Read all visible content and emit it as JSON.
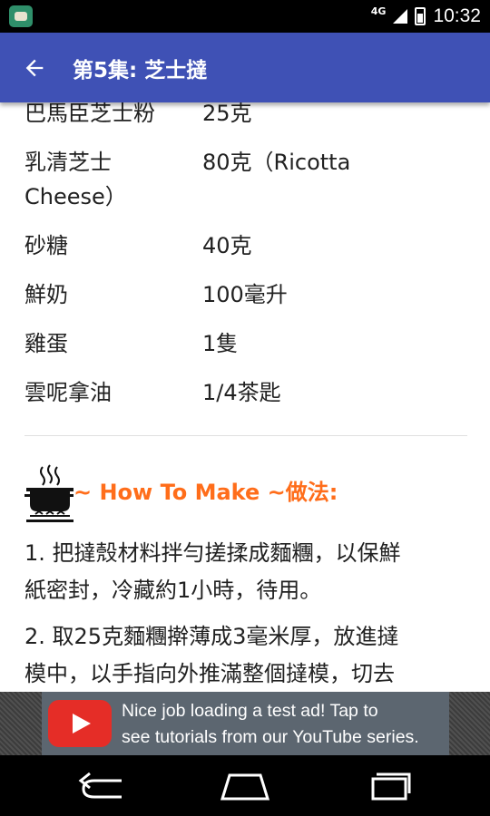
{
  "status_bar": {
    "network": "4G",
    "time": "10:32",
    "icons": [
      "app-notification-icon",
      "signal-icon",
      "battery-icon"
    ]
  },
  "app_bar": {
    "back_icon": "arrow-back-icon",
    "title": "第5集: 芝士撻"
  },
  "ingredients": [
    {
      "name": "巴馬臣芝士粉",
      "amount": "25克"
    },
    {
      "name": "乳清芝士",
      "amount": "80克（Ricotta"
    },
    {
      "name": "Cheese）",
      "amount": ""
    },
    {
      "name": "砂糖",
      "amount": "40克"
    },
    {
      "name": "鮮奶",
      "amount": "100毫升"
    },
    {
      "name": "雞蛋",
      "amount": "1隻"
    },
    {
      "name": "雲呢拿油",
      "amount": "1/4茶匙"
    }
  ],
  "how_to": {
    "icon": "cooking-pot-icon",
    "heading": "~ How To Make ~做法:"
  },
  "steps": [
    {
      "line1": "1. 把撻殼材料拌勻搓揉成麵糰，以保鮮",
      "line2": "紙密封，冷藏約1小時，待用。"
    },
    {
      "line1": "2. 取25克麵糰擀薄成3毫米厚，放進撻",
      "line2": "模中，以手指向外推滿整個撻模，切去"
    }
  ],
  "ad": {
    "logo": "youtube-logo-icon",
    "line1": "Nice job loading a test ad!  Tap to",
    "line2": "see tutorials from our YouTube series."
  },
  "nav_bar": {
    "icons": [
      "nav-back-icon",
      "nav-home-icon",
      "nav-recents-icon"
    ]
  },
  "colors": {
    "app_bar": "#3f51b5",
    "heading_accent": "#ff6d1a",
    "youtube_red": "#e52d27"
  }
}
